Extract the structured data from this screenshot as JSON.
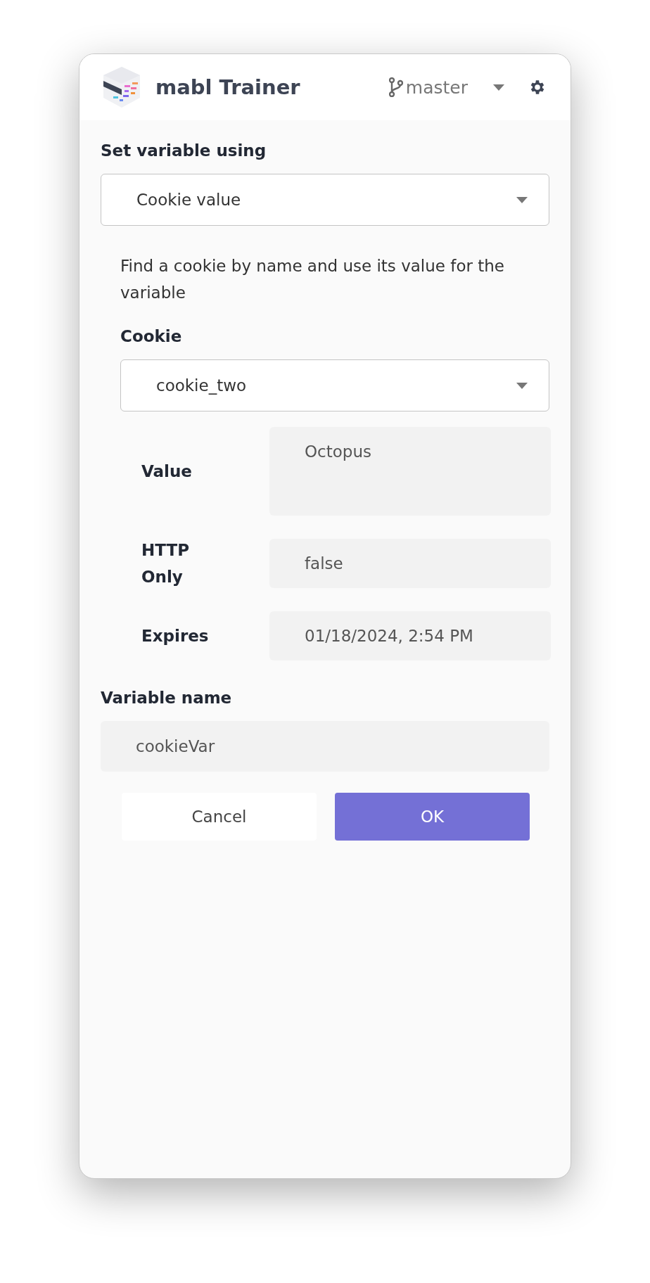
{
  "header": {
    "title": "mabl Trainer",
    "branch": "master"
  },
  "form": {
    "mode_label": "Set variable using",
    "mode_value": "Cookie value",
    "description": "Find a cookie by name and use its value for the variable",
    "cookie_label": "Cookie",
    "cookie_value": "cookie_two",
    "details": [
      {
        "label": "Value",
        "value": "Octopus",
        "kind": "multiline"
      },
      {
        "label": "HTTP Only",
        "value": "false",
        "kind": "single"
      },
      {
        "label": "Expires",
        "value": "01/18/2024, 2:54 PM",
        "kind": "single"
      }
    ],
    "variable_label": "Variable name",
    "variable_value": "cookieVar"
  },
  "buttons": [
    {
      "label": "Cancel",
      "kind": "secondary"
    },
    {
      "label": "OK",
      "kind": "primary"
    }
  ]
}
